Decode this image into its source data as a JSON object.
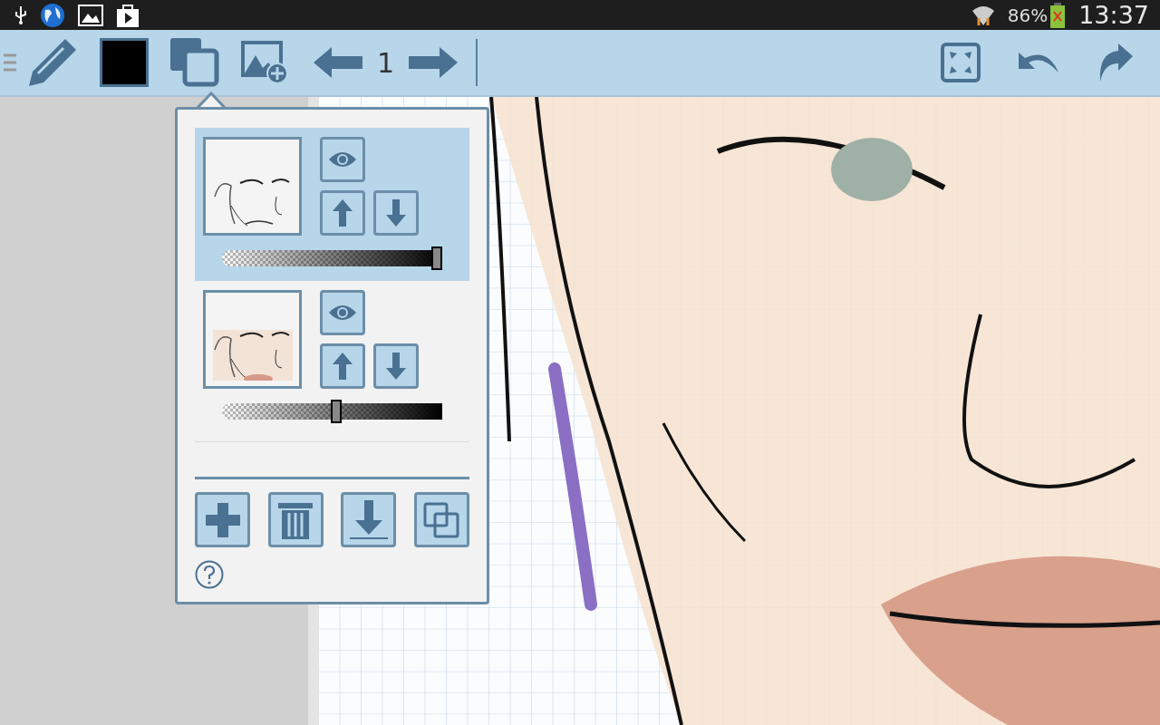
{
  "status_bar": {
    "battery": "86%",
    "time": "13:37"
  },
  "toolbar": {
    "page": "1"
  },
  "layers_panel": {
    "layers": [
      {
        "selected": true,
        "visible": true,
        "level": 1.0
      },
      {
        "selected": false,
        "visible": true,
        "level": 0.52
      }
    ]
  }
}
